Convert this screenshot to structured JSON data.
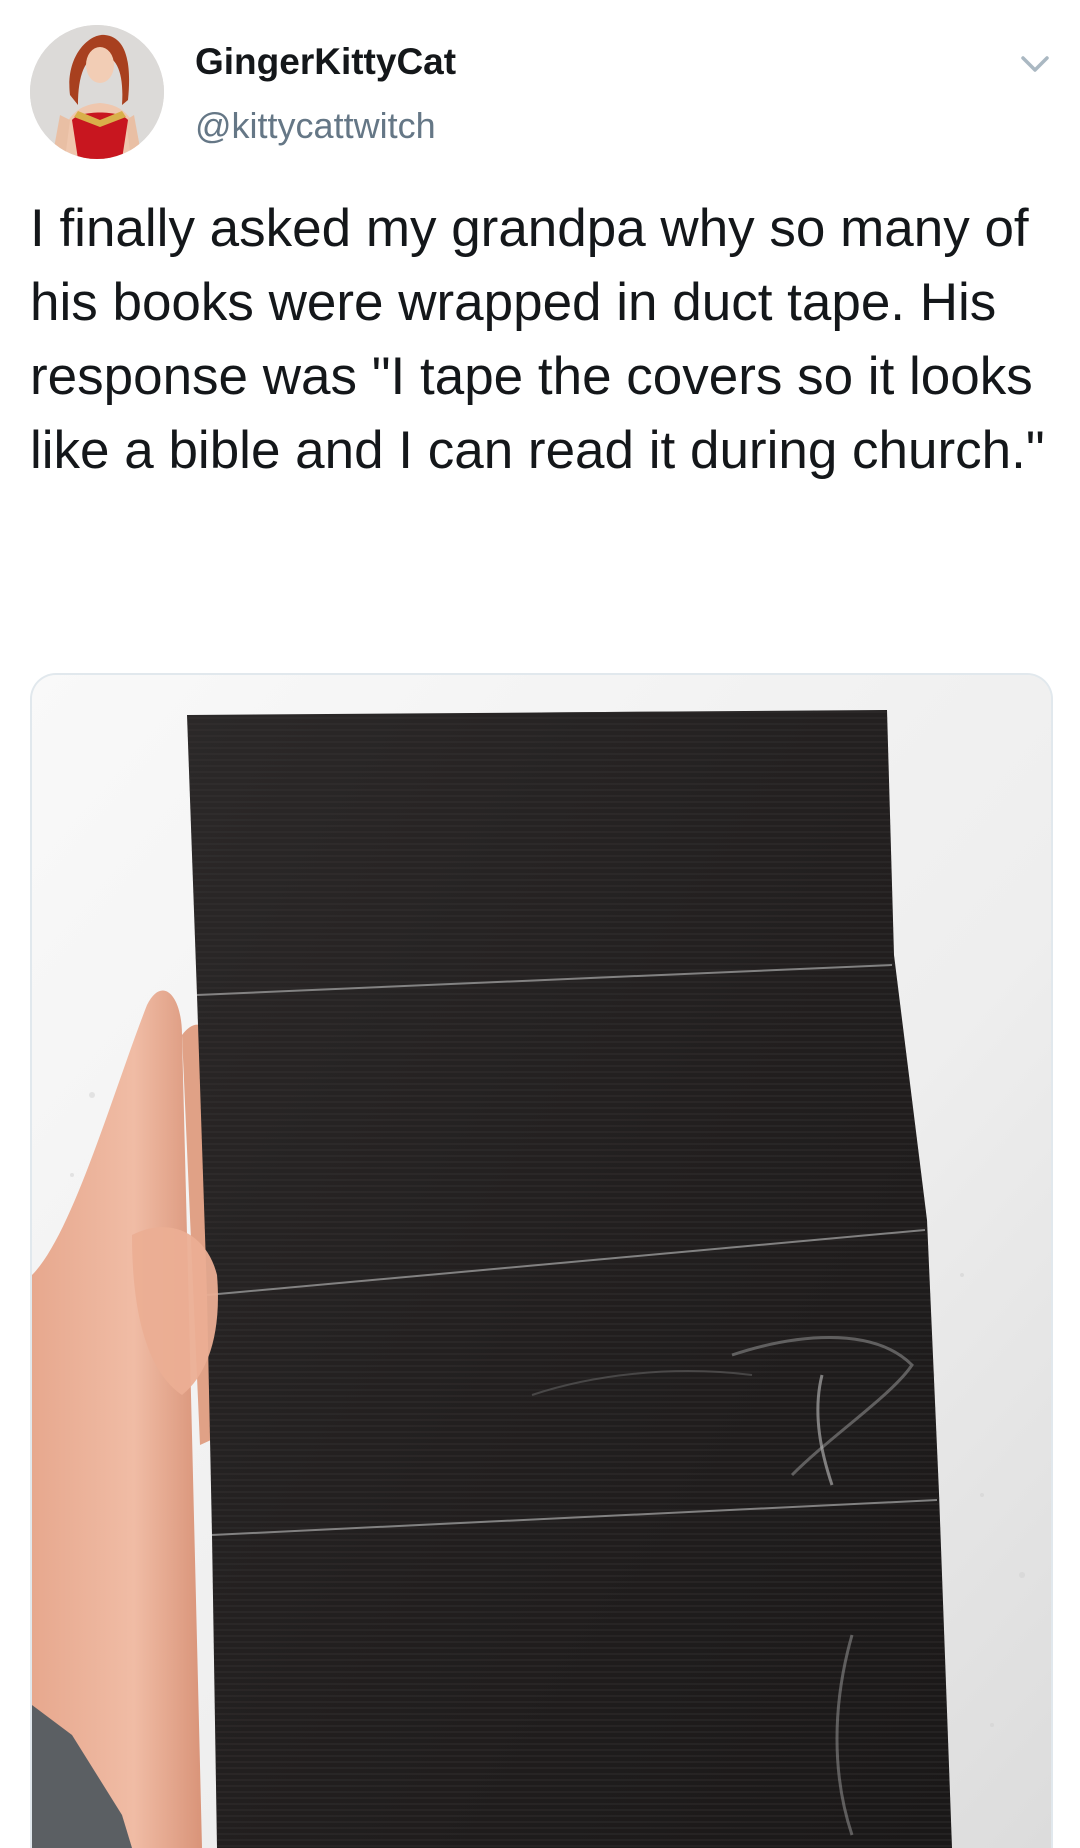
{
  "tweet": {
    "author": {
      "display_name": "GingerKittyCat",
      "handle": "@kittycattwitch",
      "avatar_icon": "profile-avatar"
    },
    "menu_icon": "chevron-down-icon",
    "text": "I finally asked my grandpa why so many of his books were wrapped in duct tape. His response was \"I tape the covers so it looks like a bible and I can read it during church.\"",
    "media": {
      "type": "photo",
      "subject": "hand holding a book wrapped in black duct tape"
    }
  },
  "colors": {
    "text": "#14171a",
    "secondary_text": "#657786",
    "border": "#e1e8ed",
    "caret": "#aab8c2"
  }
}
